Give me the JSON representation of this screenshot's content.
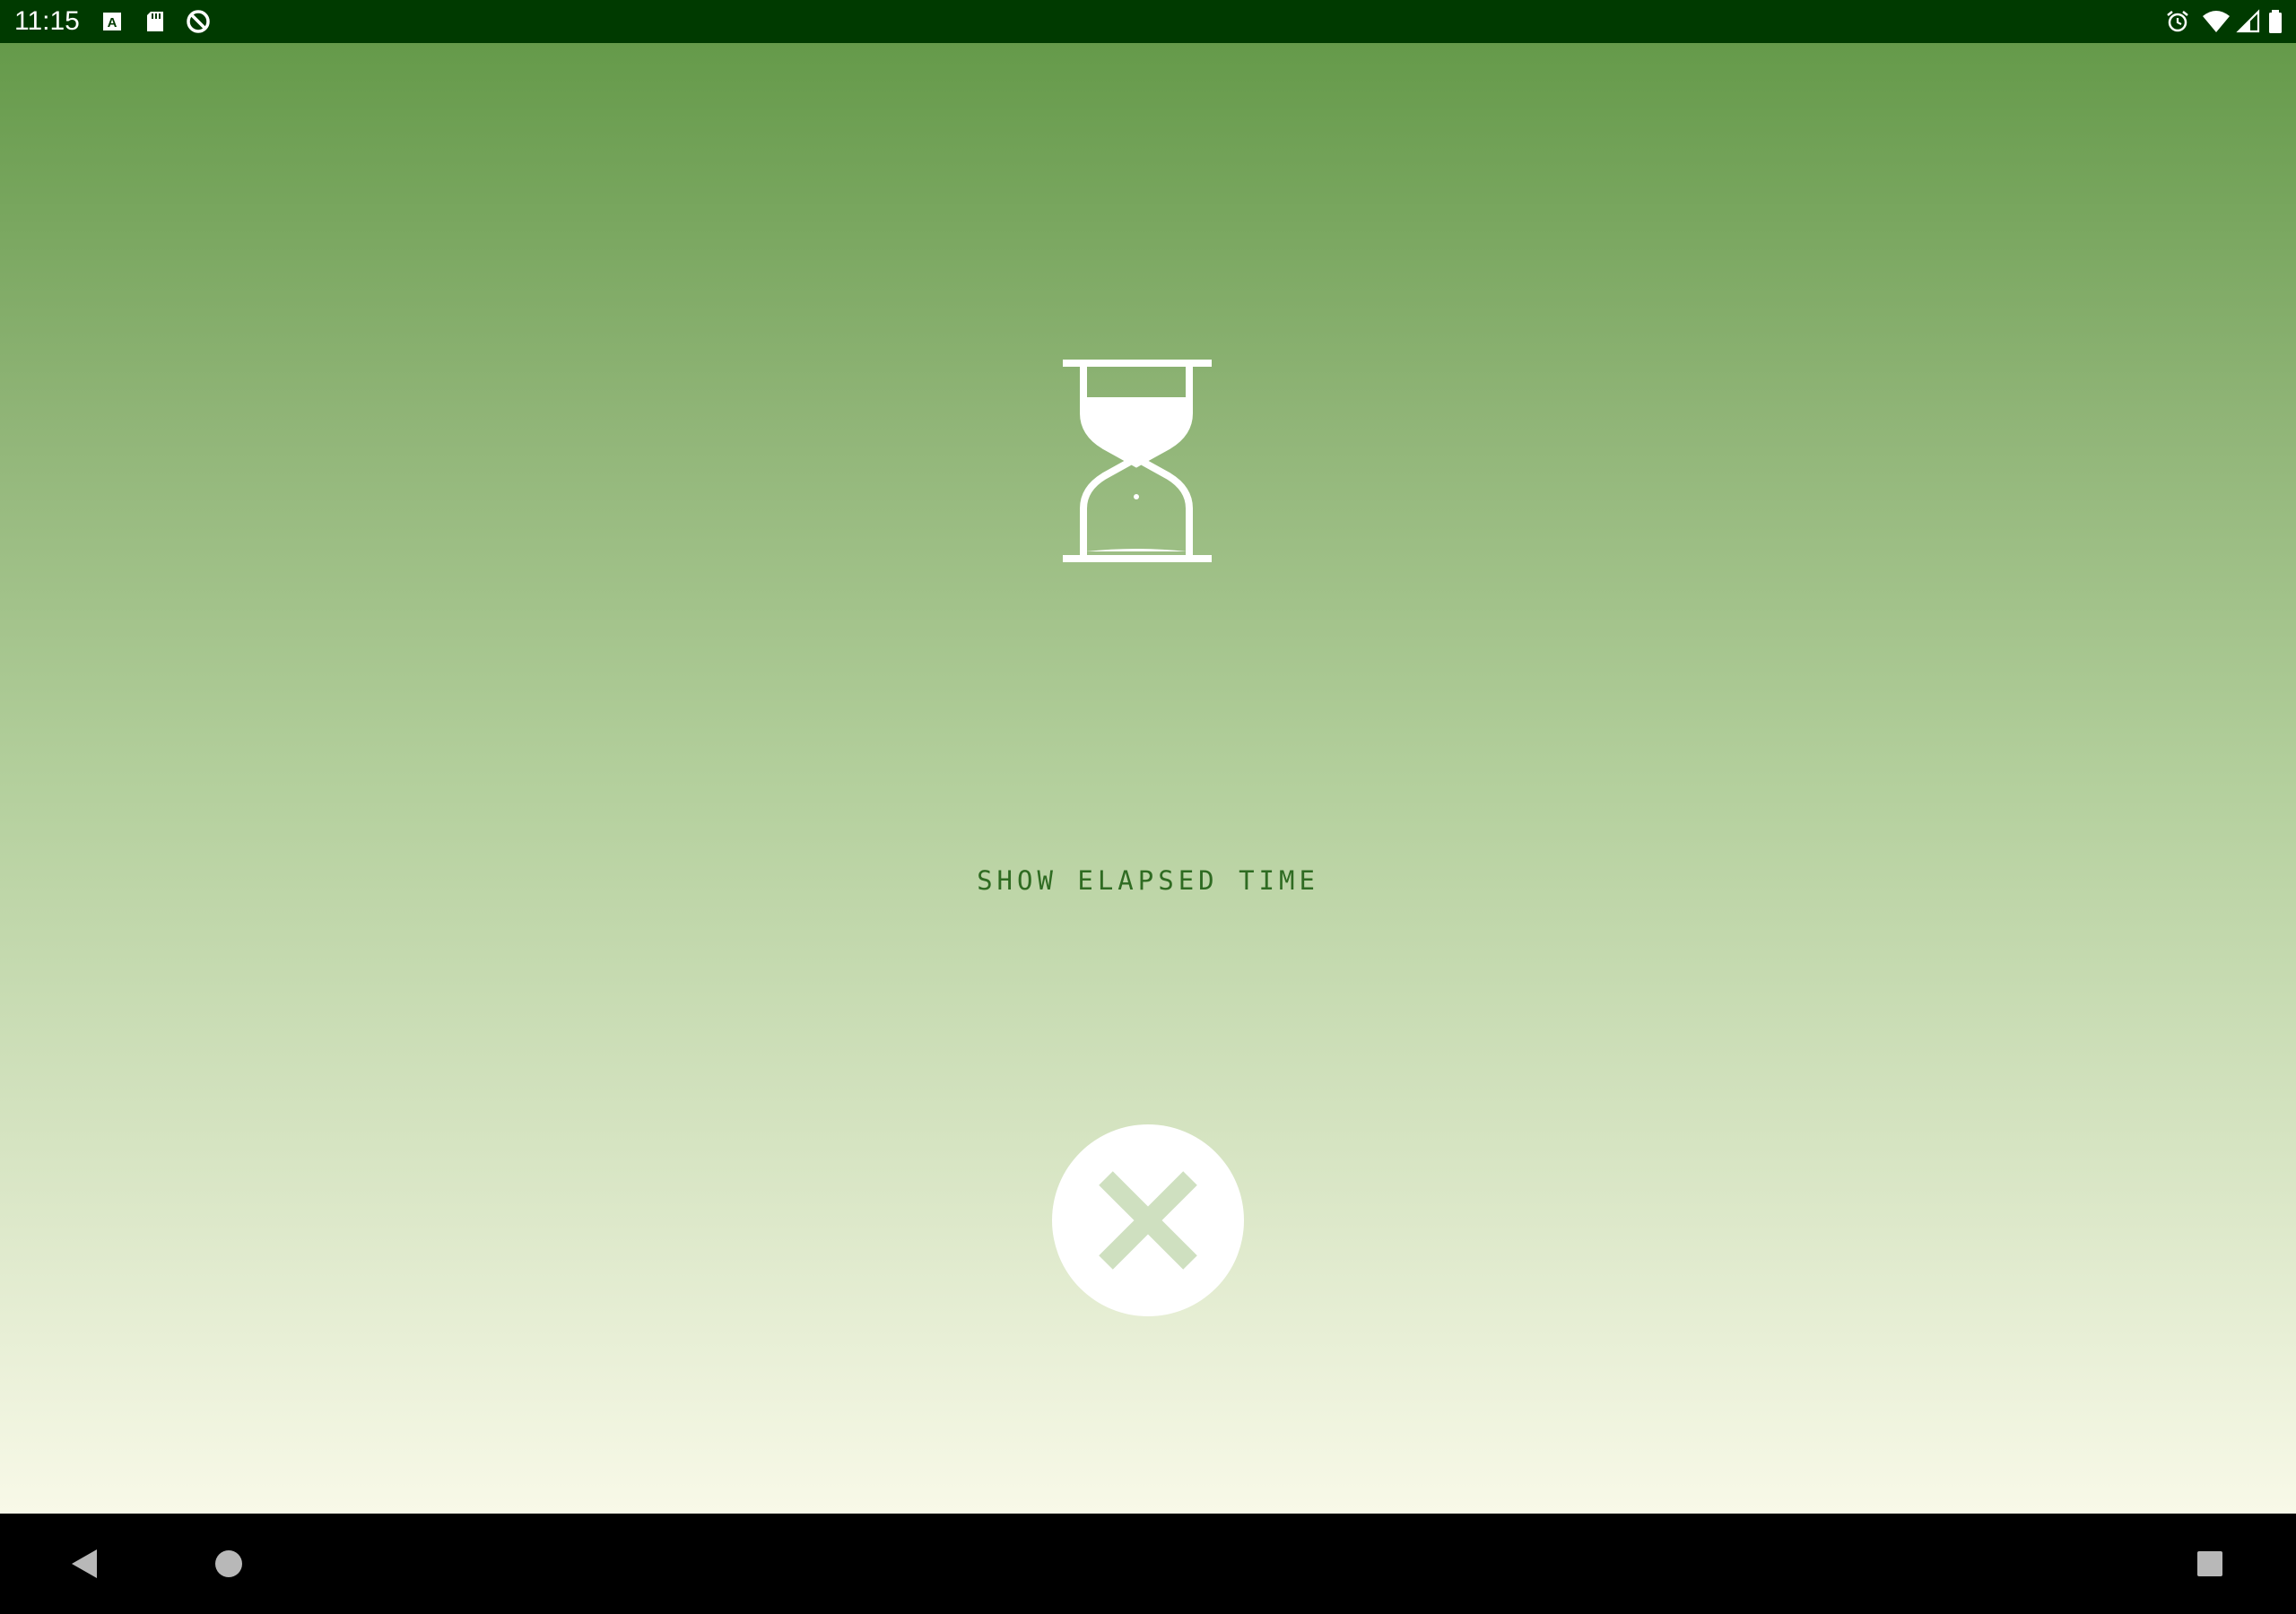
{
  "status_bar": {
    "time": "11:15",
    "left_icons": [
      "text-a-icon",
      "sd-card-icon",
      "data-saver-icon"
    ],
    "right_icons": [
      "alarm-icon",
      "wifi-icon",
      "cell-signal-icon",
      "battery-icon"
    ]
  },
  "main": {
    "icon": "hourglass-icon",
    "elapsed_label": "SHOW ELAPSED TIME",
    "close_icon": "close-icon"
  },
  "nav_bar": {
    "buttons": [
      "back-icon",
      "home-icon",
      "recents-icon"
    ]
  },
  "colors": {
    "status_bar": "#003a00",
    "gradient_top": "#659a4a",
    "gradient_bottom": "#f8f9e8",
    "label_text": "#2f6b22",
    "close_x": "#cfe0c0"
  }
}
